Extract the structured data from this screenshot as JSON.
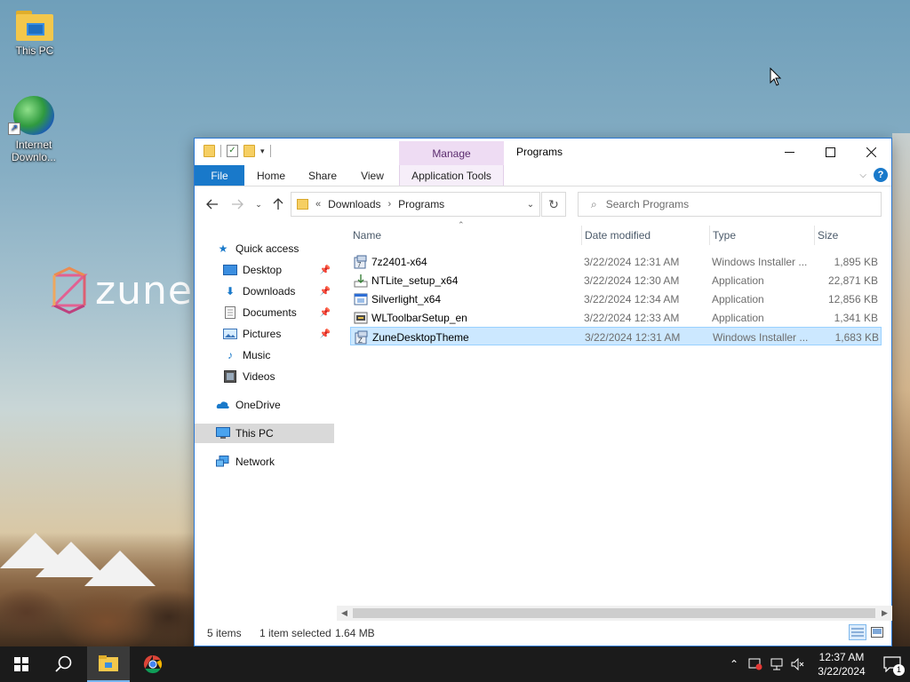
{
  "desktop": {
    "icons": [
      {
        "label": "This PC"
      },
      {
        "label": "Internet Downlo..."
      }
    ],
    "wallpaper_logo_text": "zune"
  },
  "window": {
    "title": "Programs",
    "contextual_tab": "Manage",
    "ribbon_tabs": [
      "File",
      "Home",
      "Share",
      "View",
      "Application Tools"
    ],
    "address": {
      "overflow": "«",
      "parts": [
        "Downloads",
        "Programs"
      ]
    },
    "search": {
      "placeholder": "Search Programs"
    },
    "nav_pane": {
      "quick_access": "Quick access",
      "items": [
        {
          "label": "Desktop",
          "pinned": true
        },
        {
          "label": "Downloads",
          "pinned": true
        },
        {
          "label": "Documents",
          "pinned": true
        },
        {
          "label": "Pictures",
          "pinned": true
        },
        {
          "label": "Music",
          "pinned": false
        },
        {
          "label": "Videos",
          "pinned": false
        }
      ],
      "onedrive": "OneDrive",
      "this_pc": "This PC",
      "network": "Network"
    },
    "columns": [
      "Name",
      "Date modified",
      "Type",
      "Size"
    ],
    "files": [
      {
        "name": "7z2401-x64",
        "date": "3/22/2024 12:31 AM",
        "type": "Windows Installer ...",
        "size": "1,895 KB",
        "icon": "msi-icon"
      },
      {
        "name": "NTLite_setup_x64",
        "date": "3/22/2024 12:30 AM",
        "type": "Application",
        "size": "22,871 KB",
        "icon": "setup-icon"
      },
      {
        "name": "Silverlight_x64",
        "date": "3/22/2024 12:34 AM",
        "type": "Application",
        "size": "12,856 KB",
        "icon": "app-icon"
      },
      {
        "name": "WLToolbarSetup_en",
        "date": "3/22/2024 12:33 AM",
        "type": "Application",
        "size": "1,341 KB",
        "icon": "installer-icon"
      },
      {
        "name": "ZuneDesktopTheme",
        "date": "3/22/2024 12:31 AM",
        "type": "Windows Installer ...",
        "size": "1,683 KB",
        "icon": "msi-icon",
        "selected": true
      }
    ],
    "status": {
      "item_count": "5 items",
      "selection": "1 item selected",
      "selection_size": "1.64 MB"
    }
  },
  "taskbar": {
    "clock_time": "12:37 AM",
    "clock_date": "3/22/2024",
    "notification_count": "1"
  },
  "colors": {
    "accent": "#1979ca",
    "manage_tab": "#eedcf3",
    "selection": "#cce8ff"
  }
}
